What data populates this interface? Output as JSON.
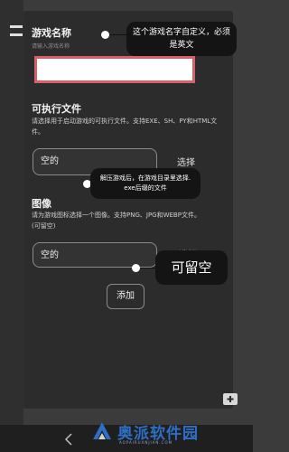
{
  "game_name": {
    "label": "游戏名称",
    "placeholder": "请输入游戏名称",
    "value": ""
  },
  "executable": {
    "label": "可执行文件",
    "description": "请选择用于启动游戏的可执行文件。支持EXE、SH、PY和HTML文件。",
    "value": "空的",
    "select_label": "选择"
  },
  "image": {
    "label": "图像",
    "description": "请为游戏图标选择一个图像。支持PNG、JPG和WEBP文件。(可留空)",
    "value": "空的",
    "select_label": "选择"
  },
  "add_button": "添加",
  "annotations": {
    "name_tip": "这个游戏名字自定义，必须是英文",
    "exe_tip": "解压游戏后，在游戏目录里选择. exe后缀的文件",
    "image_tip": "可留空"
  },
  "watermark": {
    "text": "奥派软件园",
    "url": "AOPAIRUANJIAN.COM"
  },
  "colors": {
    "highlight": "#d9606b",
    "watermark": "#2e6fc6"
  }
}
